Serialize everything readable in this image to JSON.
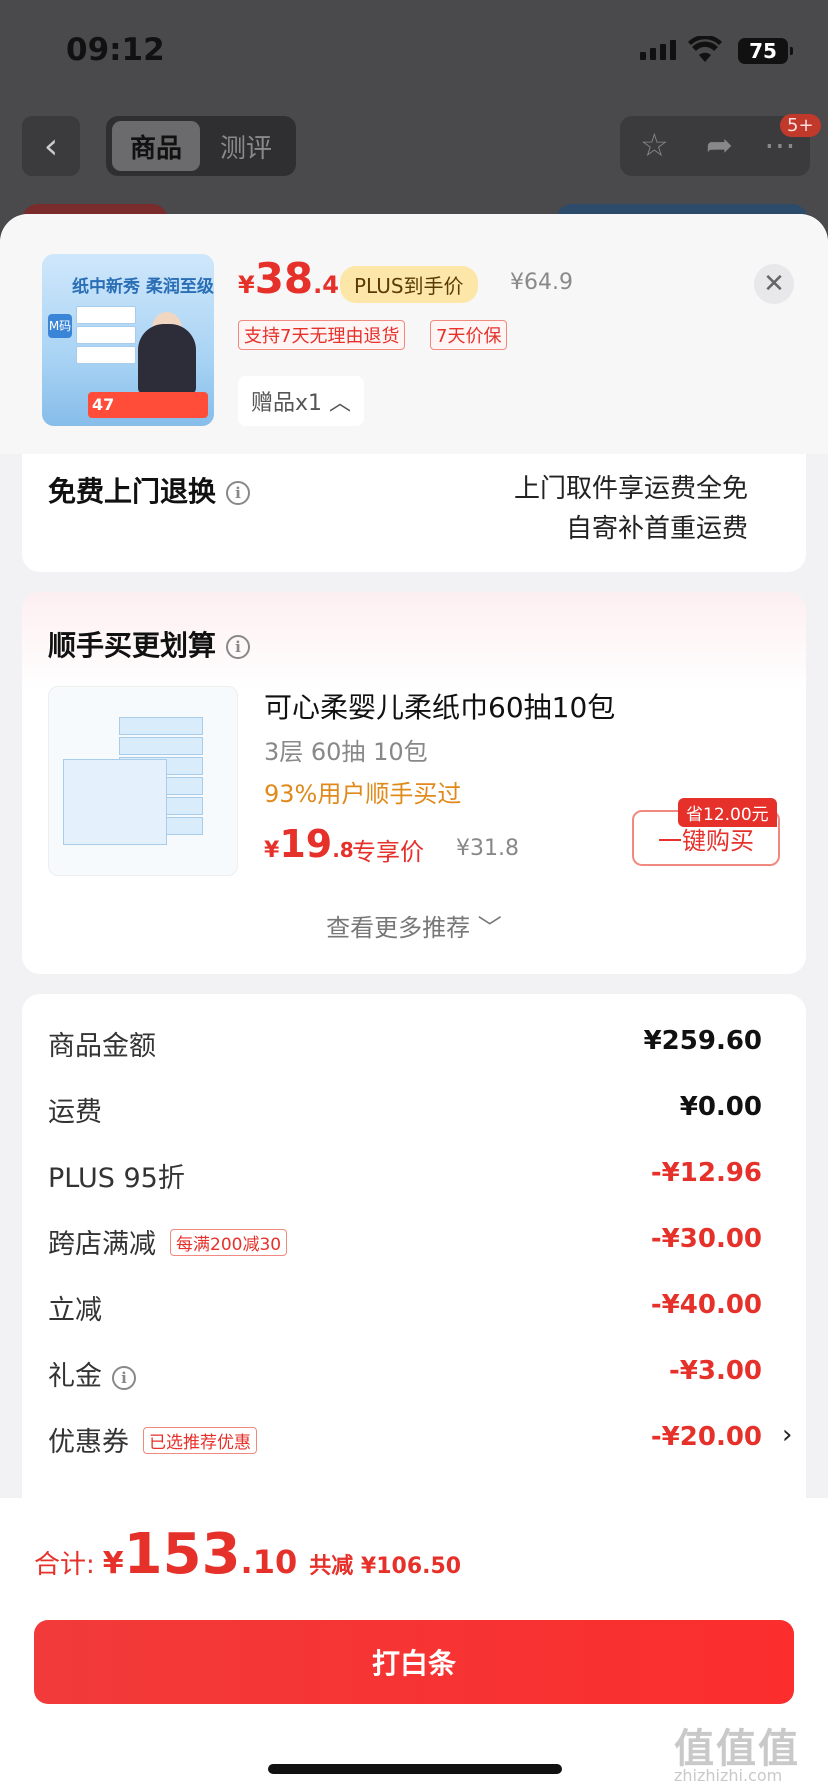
{
  "status_bar": {
    "time": "09:12",
    "battery": "75"
  },
  "nav": {
    "back_icon": "chevron-left-icon",
    "tabs": [
      {
        "label": "商品"
      },
      {
        "label": "测评"
      }
    ],
    "notif_badge": "5+"
  },
  "header": {
    "thumb_text": "纸中新秀 柔润至级",
    "thumb_badge": "M码",
    "thumb_price": "47",
    "price_currency": "¥",
    "price_int": "38",
    "price_dec": ".41",
    "plus_tag": "PLUS到手价",
    "original_price": "¥64.9",
    "tags": [
      "支持7天无理由退货",
      "7天价保"
    ],
    "gift_label": "赠品x1 ︿"
  },
  "return_card": {
    "title": "免费上门退换",
    "line1": "上门取件享运费全免",
    "line2": "自寄补首重运费"
  },
  "recommend_card": {
    "title": "顺手买更划算",
    "product_name": "可心柔婴儿柔纸巾60抽10包",
    "spec": "3层 60抽 10包",
    "bought": "93%用户顺手买过",
    "price_currency": "¥",
    "price_int": "19",
    "price_dec": ".8",
    "exclusive": "专享价",
    "original_price": "¥31.8",
    "save_tag": "省12.00元",
    "buy_label": "一键购买",
    "more_label": "查看更多推荐 ﹀"
  },
  "summary": {
    "rows": [
      {
        "label": "商品金额",
        "value": "¥259.60",
        "tag": ""
      },
      {
        "label": "运费",
        "value": "¥0.00",
        "tag": ""
      },
      {
        "label": "PLUS 95折",
        "value": "-¥12.96",
        "tag": ""
      },
      {
        "label": "跨店满减",
        "value": "-¥30.00",
        "tag": "每满200减30"
      },
      {
        "label": "立减",
        "value": "-¥40.00",
        "tag": ""
      },
      {
        "label": "礼金",
        "value": "-¥3.00",
        "tag": ""
      },
      {
        "label": "优惠券",
        "value": "-¥20.00",
        "tag": "已选推荐优惠"
      }
    ],
    "chevron": "›"
  },
  "footer": {
    "total_label": "合计:",
    "total_currency": "¥",
    "total_int": "153",
    "total_dec": ".10",
    "total_saved": "共减 ¥106.50",
    "pay_label": "打白条",
    "watermark": "值值值",
    "watermark_sub": "zhizhizhi.com"
  },
  "colors": {
    "accent": "#e6312b",
    "plus": "#fde7a8",
    "overlay": "#4a4a4c"
  }
}
